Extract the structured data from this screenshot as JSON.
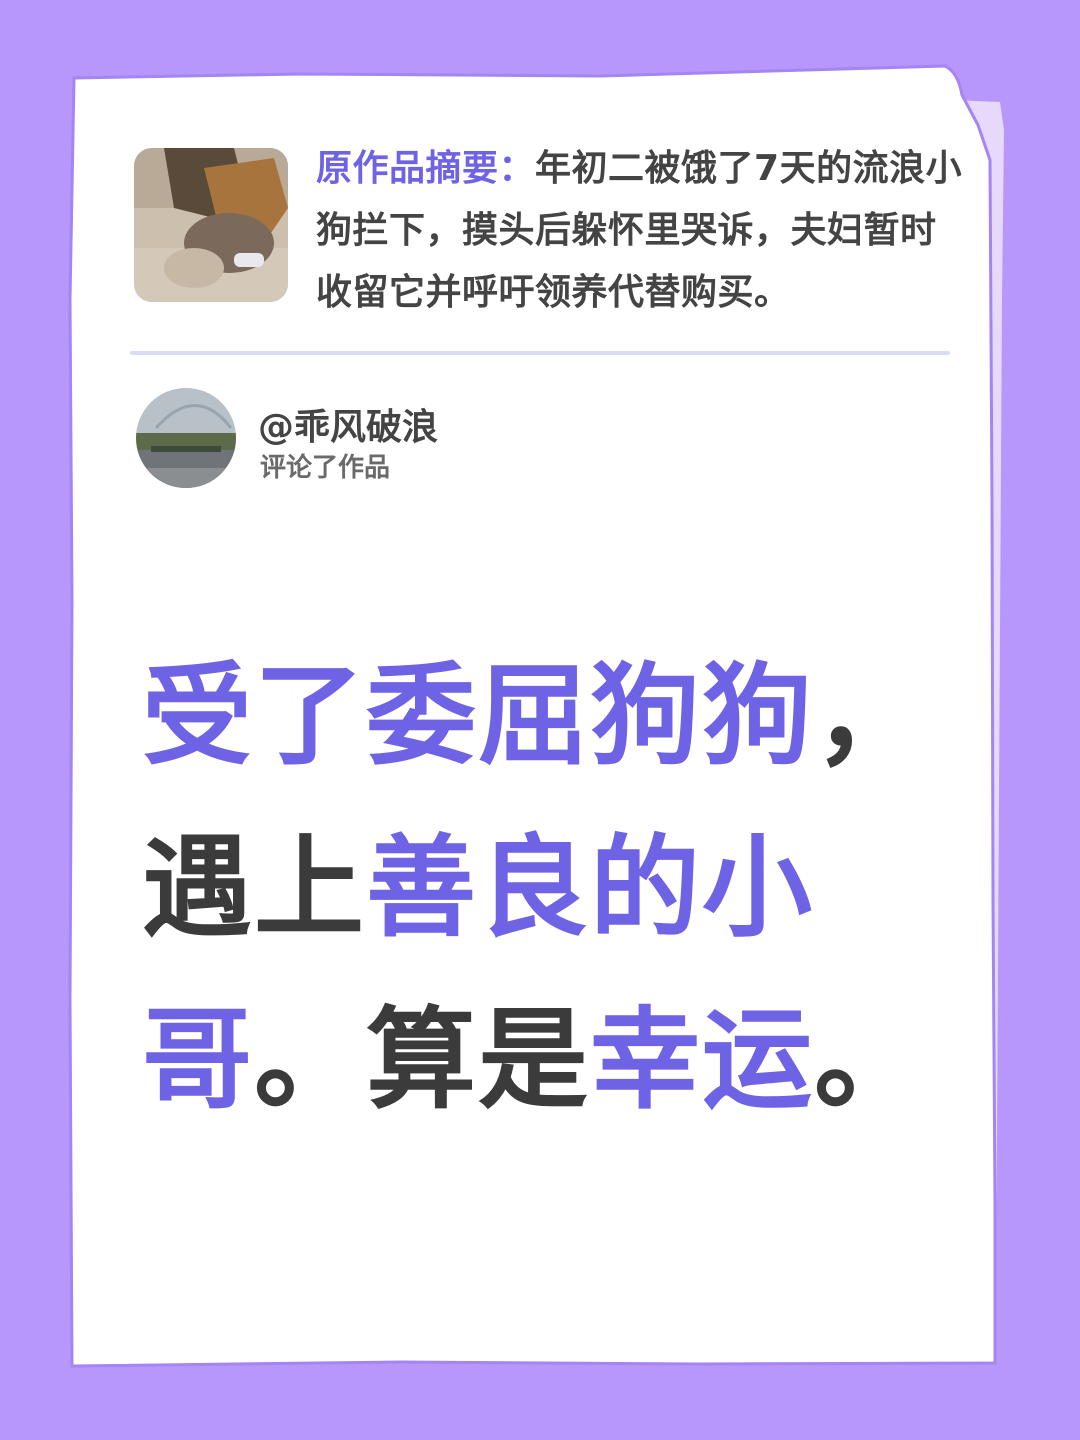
{
  "summary": {
    "label": "原作品摘要：",
    "text": "年初二被饿了7天的流浪小狗拦下，摸头后躲怀里哭诉，夫妇暂时收留它并呼吁领养代替购买。"
  },
  "comment": {
    "username": "@乖风破浪",
    "action": "评论了作品"
  },
  "headline": {
    "line1": "受了委屈狗狗",
    "line1_punct": "，",
    "line2_dark": "遇上",
    "line2_highlight": "善良的小",
    "line3_highlight": "哥",
    "line3_punct": "。",
    "line3_dark": "算是",
    "line3_highlight2": "幸运",
    "line3_end": "。"
  },
  "colors": {
    "background": "#b797fb",
    "accent": "#6f63e5",
    "dark_text": "#3b3b3b"
  },
  "icons": {
    "thumbnail": "dog-photo-thumbnail",
    "avatar": "landscape-avatar"
  }
}
